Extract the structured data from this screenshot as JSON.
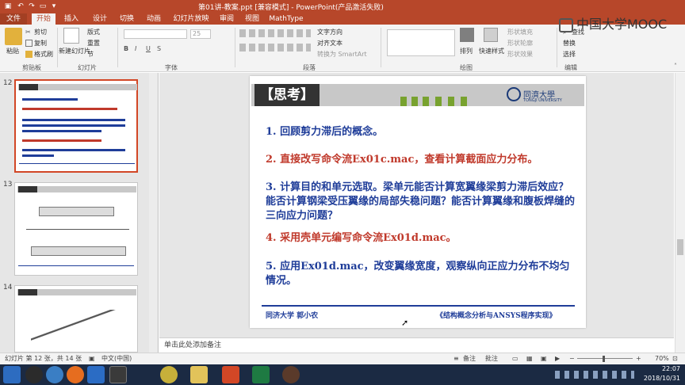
{
  "window": {
    "title": "第01讲-教案.ppt [兼容模式] - PowerPoint(产品激活失败)"
  },
  "brand": {
    "mooc_text": "中国大学MOOC"
  },
  "tabs": [
    "文件",
    "开始",
    "插入",
    "设计",
    "切换",
    "动画",
    "幻灯片放映",
    "审阅",
    "视图",
    "MathType"
  ],
  "ribbon": {
    "clipboard": {
      "paste": "粘贴",
      "cut": "剪切",
      "copy": "复制",
      "format_painter": "格式刷",
      "group": "剪贴板"
    },
    "slides": {
      "new_slide": "新建幻灯片",
      "layout": "版式",
      "reset": "重置",
      "section": "节",
      "group": "幻灯片"
    },
    "font": {
      "font_size": "25",
      "group": "字体"
    },
    "paragraph": {
      "text_direction": "文字方向",
      "align_text": "对齐文本",
      "smartart": "转换为 SmartArt",
      "group": "段落"
    },
    "drawing": {
      "arrange": "排列",
      "quick_styles": "快速样式",
      "shape_fill": "形状填充",
      "shape_outline": "形状轮廓",
      "shape_effects": "形状效果",
      "group": "绘图"
    },
    "editing": {
      "find": "查找",
      "replace": "替换",
      "select": "选择",
      "group": "编辑"
    }
  },
  "thumbnails": [
    {
      "number": "12",
      "selected": true
    },
    {
      "number": "13",
      "selected": false
    },
    {
      "number": "14",
      "selected": false
    }
  ],
  "slide": {
    "header": "【思考】",
    "university_name": "同濟大學",
    "university_sub": "TONGJI UNIVERSITY",
    "items": [
      {
        "text": "1. 回顾剪力滞后的概念。",
        "color": "#1f3d99"
      },
      {
        "text": "2. 直接改写命令流Ex01c.mac，查看计算截面应力分布。",
        "color": "#c0392b"
      },
      {
        "text": "3.  计算目的和单元选取。梁单元能否计算宽翼缘梁剪力滞后效应？能否计算钢梁受压翼缘的局部失稳问题？能否计算翼缘和腹板焊缝的三向应力问题？",
        "color": "#1f3d99"
      },
      {
        "text": "4. 采用壳单元编写命令流Ex01d.mac。",
        "color": "#c0392b"
      },
      {
        "text": "5. 应用Ex01d.mac，改变翼缘宽度，观察纵向正应力分布不均匀情况。",
        "color": "#1f3d99"
      }
    ],
    "footer_left": "同济大学  郭小农",
    "footer_right": "《结构概念分析与ANSYS程序实现》"
  },
  "notes": {
    "placeholder": "单击此处添加备注"
  },
  "statusbar": {
    "slide_info": "幻灯片 第 12 张，共 14 张",
    "language": "中文(中国)",
    "notes": "备注",
    "comments": "批注",
    "zoom": "70%"
  },
  "taskbar": {
    "time": "22:07",
    "date": "2018/10/31"
  }
}
